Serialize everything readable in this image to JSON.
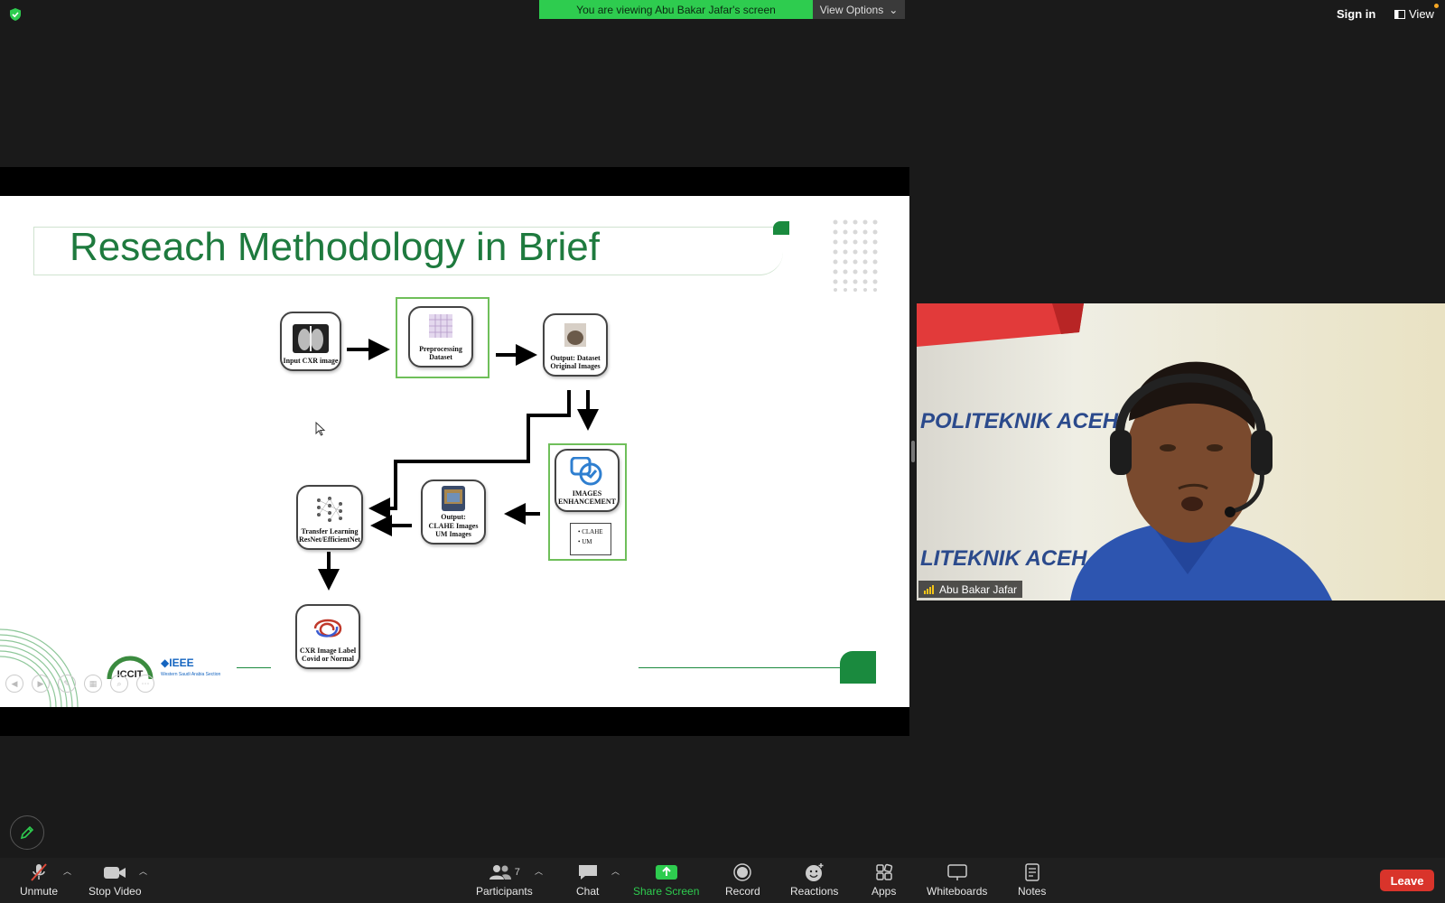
{
  "top_bar": {
    "banner_text": "You are viewing Abu Bakar Jafar's screen",
    "view_options_label": "View Options",
    "sign_in_label": "Sign in",
    "view_label": "View"
  },
  "slide": {
    "title": "Reseach Methodology in Brief",
    "nodes": {
      "input": "Input CXR image",
      "preprocessing": "Preprocessing Dataset",
      "output_original": "Output: Dataset Original Images",
      "enhancement": "IMAGES ENHANCEMENT",
      "enhancement_items": [
        "CLAHE",
        "UM"
      ],
      "output_enhanced_1": "Output:",
      "output_enhanced_2": "CLAHE  Images",
      "output_enhanced_3": "UM Images",
      "transfer": "Transfer Learning ResNet/EfficientNet",
      "label": "CXR Image Label Covid or Normal"
    },
    "logos": {
      "iccit": "ICCIT",
      "ieee": "IEEE",
      "ieee_sub": "Western Saudi Arabia Section"
    }
  },
  "video": {
    "participant_name": "Abu Bakar Jafar",
    "wall_text_1": "POLITEKNIK ACEH",
    "wall_text_2": "LITEKNIK ACEH"
  },
  "toolbar": {
    "unmute": "Unmute",
    "stop_video": "Stop Video",
    "participants": "Participants",
    "participants_count": "7",
    "chat": "Chat",
    "share_screen": "Share Screen",
    "record": "Record",
    "reactions": "Reactions",
    "apps": "Apps",
    "whiteboards": "Whiteboards",
    "notes": "Notes",
    "leave": "Leave"
  },
  "colors": {
    "banner": "#2ecc4f",
    "title_green": "#1e7a3e",
    "leave_red": "#d9342b"
  }
}
